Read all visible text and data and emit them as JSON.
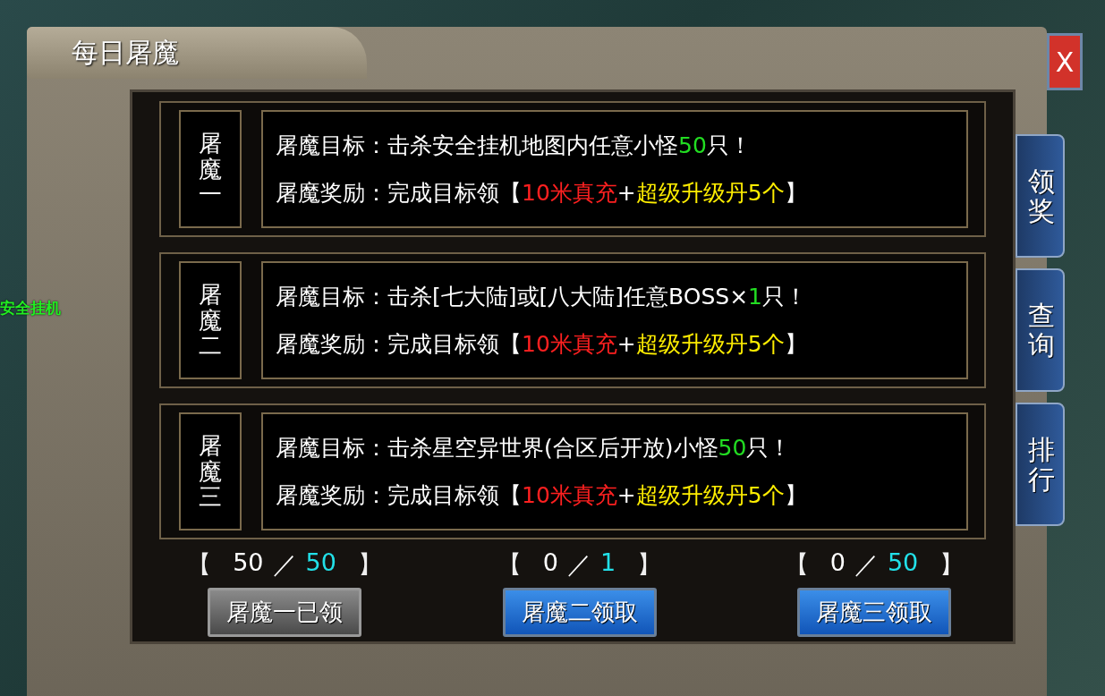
{
  "scene_label": "安全挂机",
  "title": "每日屠魔",
  "close": "X",
  "side_tabs": [
    {
      "label": "领奖"
    },
    {
      "label": "查询"
    },
    {
      "label": "排行"
    }
  ],
  "quests": [
    {
      "badge": "屠魔一",
      "goal": [
        {
          "text": "屠魔目标：",
          "color": "#ffffff"
        },
        {
          "text": "击杀安全挂机地图内任意小怪",
          "color": "#ffffff"
        },
        {
          "text": "50",
          "color": "#22dd22"
        },
        {
          "text": "只！",
          "color": "#ffffff"
        }
      ],
      "reward": [
        {
          "text": "屠魔奖励：完成目标领",
          "color": "#ffffff"
        },
        {
          "text": "【",
          "color": "#ffffff"
        },
        {
          "text": "10米真充",
          "color": "#ff2020"
        },
        {
          "text": "+",
          "color": "#ffffff"
        },
        {
          "text": "超级升级丹5个",
          "color": "#ffee00"
        },
        {
          "text": "】",
          "color": "#ffffff"
        }
      ]
    },
    {
      "badge": "屠魔二",
      "goal": [
        {
          "text": "屠魔目标：",
          "color": "#ffffff"
        },
        {
          "text": "击杀[七大陆]或[八大陆]任意BOSS×",
          "color": "#ffffff"
        },
        {
          "text": "1",
          "color": "#22dd22"
        },
        {
          "text": "只！",
          "color": "#ffffff"
        }
      ],
      "reward": [
        {
          "text": "屠魔奖励：完成目标领",
          "color": "#ffffff"
        },
        {
          "text": "【",
          "color": "#ffffff"
        },
        {
          "text": "10米真充",
          "color": "#ff2020"
        },
        {
          "text": "+",
          "color": "#ffffff"
        },
        {
          "text": "超级升级丹5个",
          "color": "#ffee00"
        },
        {
          "text": "】",
          "color": "#ffffff"
        }
      ]
    },
    {
      "badge": "屠魔三",
      "goal": [
        {
          "text": "屠魔目标：",
          "color": "#ffffff"
        },
        {
          "text": "击杀星空异世界(合区后开放)小怪",
          "color": "#ffffff"
        },
        {
          "text": "50",
          "color": "#22dd22"
        },
        {
          "text": "只！",
          "color": "#ffffff"
        }
      ],
      "reward": [
        {
          "text": "屠魔奖励：完成目标领",
          "color": "#ffffff"
        },
        {
          "text": "【",
          "color": "#ffffff"
        },
        {
          "text": "10米真充",
          "color": "#ff2020"
        },
        {
          "text": "+",
          "color": "#ffffff"
        },
        {
          "text": "超级升级丹5个",
          "color": "#ffee00"
        },
        {
          "text": "】",
          "color": "#ffffff"
        }
      ]
    }
  ],
  "claims": [
    {
      "open": "【",
      "current": "50",
      "sep": "／",
      "target": "50",
      "close": "】",
      "button": "屠魔一已领",
      "claimed": true
    },
    {
      "open": "【",
      "current": "0",
      "sep": "／",
      "target": "1",
      "close": "】",
      "button": "屠魔二领取",
      "claimed": false
    },
    {
      "open": "【",
      "current": "0",
      "sep": "／",
      "target": "50",
      "close": "】",
      "button": "屠魔三领取",
      "claimed": false
    }
  ]
}
